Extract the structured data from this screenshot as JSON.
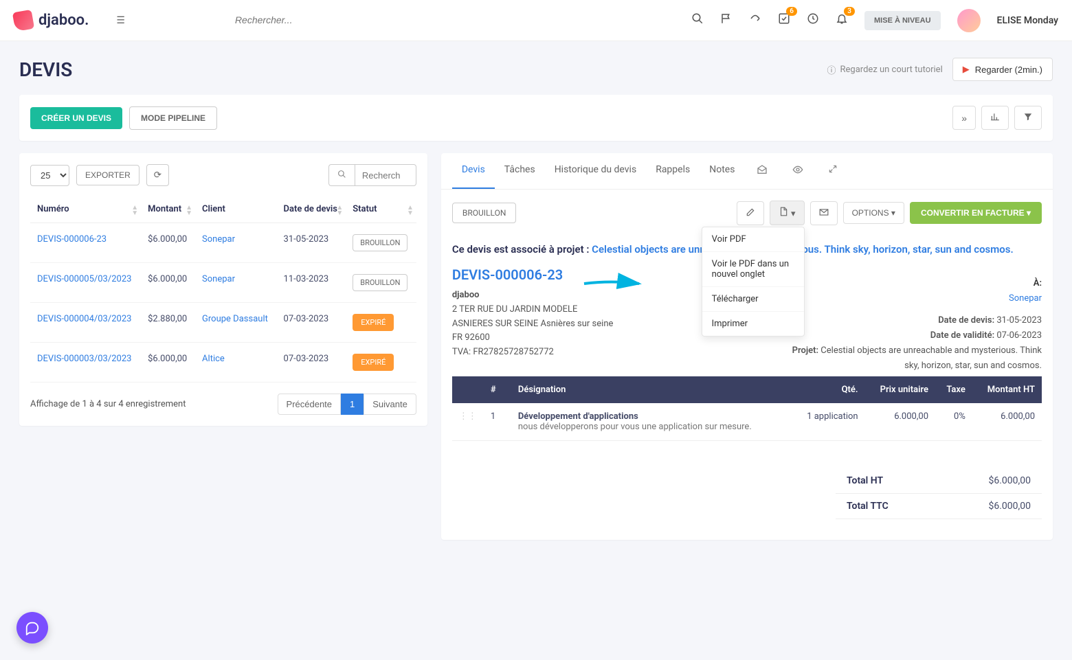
{
  "topbar": {
    "logo": "djaboo",
    "search_placeholder": "Rechercher...",
    "badge_tasks": "6",
    "badge_notif": "3",
    "upgrade": "MISE À NIVEAU",
    "user": "ELISE Monday"
  },
  "page": {
    "title": "DEVIS",
    "tutorial": "Regardez un court tutoriel",
    "watch": "Regarder (2min.)"
  },
  "actions": {
    "create": "CRÉER UN DEVIS",
    "pipeline": "MODE PIPELINE"
  },
  "list": {
    "page_size": "25",
    "export": "EXPORTER",
    "search_placeholder": "Recherch",
    "cols": {
      "num": "Numéro",
      "amount": "Montant",
      "client": "Client",
      "date": "Date de devis",
      "status": "Statut"
    },
    "rows": [
      {
        "num": "DEVIS-000006-23",
        "amount": "$6.000,00",
        "client": "Sonepar",
        "date": "31-05-2023",
        "status": "BROUILLON",
        "status_type": "draft"
      },
      {
        "num": "DEVIS-000005/03/2023",
        "amount": "$6.000,00",
        "client": "Sonepar",
        "date": "11-03-2023",
        "status": "BROUILLON",
        "status_type": "draft"
      },
      {
        "num": "DEVIS-000004/03/2023",
        "amount": "$2.880,00",
        "client": "Groupe Dassault",
        "date": "07-03-2023",
        "status": "EXPIRÉ",
        "status_type": "expired"
      },
      {
        "num": "DEVIS-000003/03/2023",
        "amount": "$6.000,00",
        "client": "Altice",
        "date": "07-03-2023",
        "status": "EXPIRÉ",
        "status_type": "expired"
      }
    ],
    "footer": "Affichage de 1 à 4 sur 4 enregistrement",
    "prev": "Précédente",
    "pg": "1",
    "next": "Suivante"
  },
  "detail": {
    "tabs": {
      "devis": "Devis",
      "taches": "Tâches",
      "hist": "Historique du devis",
      "rappels": "Rappels",
      "notes": "Notes"
    },
    "draft": "BROUILLON",
    "options": "OPTIONS",
    "convert": "CONVERTIR EN FACTURE",
    "dropdown": {
      "view": "Voir PDF",
      "newtab": "Voir le PDF dans un nouvel onglet",
      "download": "Télécharger",
      "print": "Imprimer"
    },
    "assoc_prefix": "Ce devis est associé à projet : ",
    "assoc_link": "Celestial objects are unreachable and mysterious. Think sky, horizon, star, sun and cosmos.",
    "number": "DEVIS-000006-23",
    "company": {
      "name": "djaboo",
      "addr1": "2 TER RUE DU JARDIN MODELE",
      "addr2": "ASNIERES SUR SEINE Asnières sur seine",
      "addr3": "FR 92600",
      "tva": "TVA: FR27825728752772"
    },
    "meta": {
      "a_label": "À:",
      "client": "Sonepar",
      "date_devis_label": "Date de devis:",
      "date_devis": "31-05-2023",
      "date_valid_label": "Date de validité:",
      "date_valid": "07-06-2023",
      "projet_label": "Projet:",
      "projet": "Celestial objects are unreachable and mysterious. Think sky, horizon, star, sun and cosmos."
    },
    "items": {
      "cols": {
        "hash": "#",
        "desig": "Désignation",
        "qty": "Qté.",
        "price": "Prix unitaire",
        "tax": "Taxe",
        "total": "Montant HT"
      },
      "row": {
        "idx": "1",
        "title": "Développement d'applications",
        "desc": "nous développerons pour vous une application sur mesure.",
        "qty": "1 application",
        "price": "6.000,00",
        "tax": "0%",
        "total": "6.000,00"
      }
    },
    "totals": {
      "ht_label": "Total HT",
      "ht": "$6.000,00",
      "ttc_label": "Total TTC",
      "ttc": "$6.000,00"
    }
  }
}
